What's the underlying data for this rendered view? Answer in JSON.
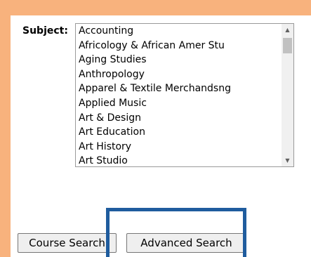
{
  "form": {
    "subject_label": "Subject:",
    "subject_options": [
      "Accounting",
      "Africology & African Amer Stu",
      "Aging Studies",
      "Anthropology",
      "Apparel & Textile Merchandsng",
      "Applied Music",
      "Art & Design",
      "Art Education",
      "Art History",
      "Art Studio"
    ]
  },
  "buttons": {
    "course_search": "Course Search",
    "advanced_search": "Advanced Search"
  },
  "scrollbar": {
    "up_glyph": "▲",
    "down_glyph": "▼"
  },
  "colors": {
    "background": "#f8b27d",
    "highlight": "#1f5c9e"
  }
}
